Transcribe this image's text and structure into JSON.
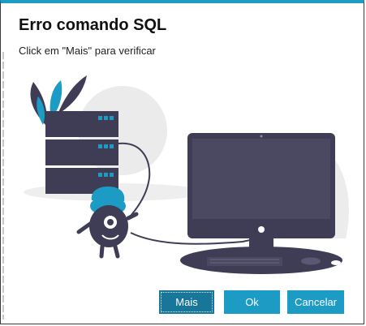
{
  "dialog": {
    "title": "Erro comando SQL",
    "message": "Click em \"Mais\" para verificar"
  },
  "buttons": {
    "more": "Mais",
    "ok": "Ok",
    "cancel": "Cancelar"
  },
  "colors": {
    "accent": "#1c9bc4",
    "focused_button": "#17769a",
    "device_dark": "#3f3d56",
    "screen": "#4b4862",
    "background_blob": "#ebebeb"
  },
  "illustration": {
    "name": "server-monitor-error-illustration"
  }
}
